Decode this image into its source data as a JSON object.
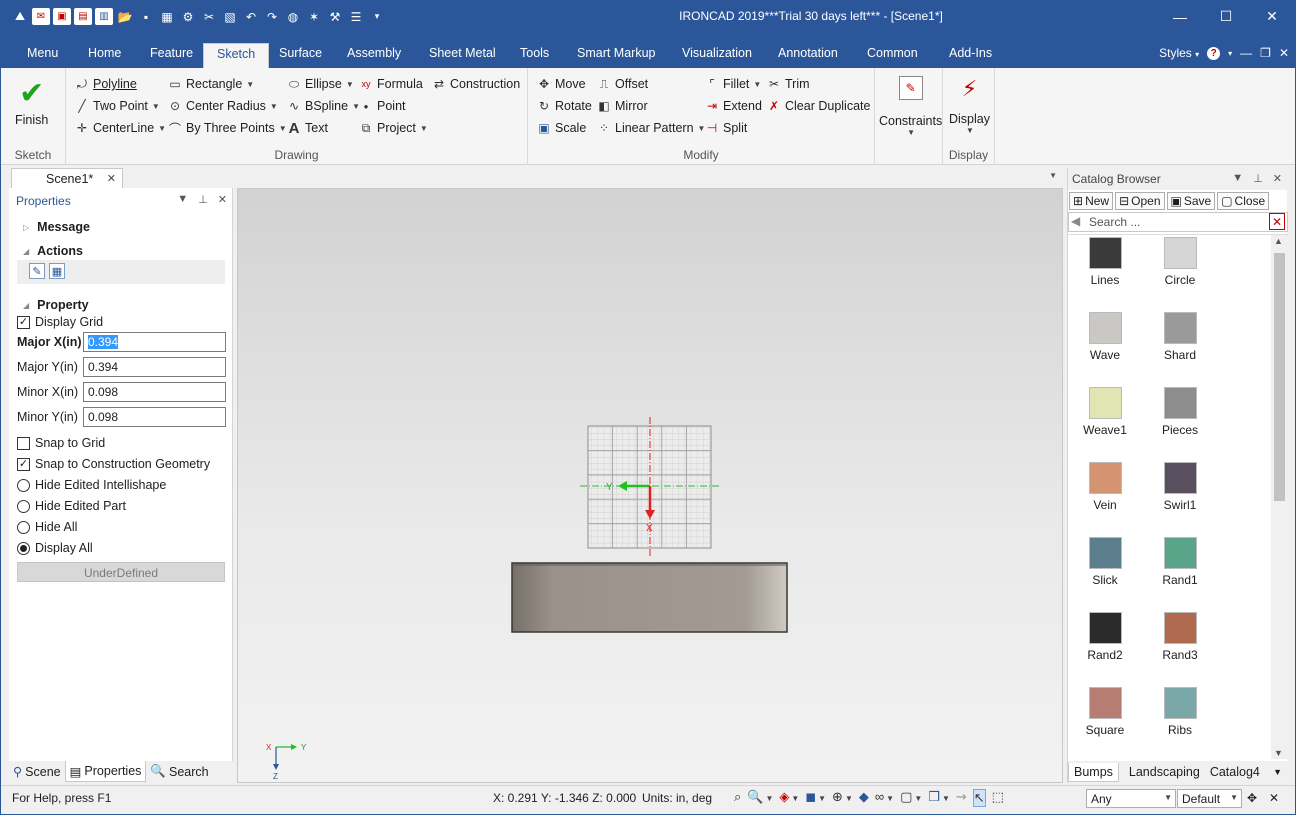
{
  "window": {
    "title": "IRONCAD 2019***Trial 30 days left*** - [Scene1*]"
  },
  "colors": {
    "titlebar": "#2b579a",
    "accent": "#2b579a",
    "selection": "#3399ff",
    "warning": "#c00000"
  },
  "menu_tabs": [
    {
      "label": "Menu"
    },
    {
      "label": "Home"
    },
    {
      "label": "Feature"
    },
    {
      "label": "Sketch"
    },
    {
      "label": "Surface"
    },
    {
      "label": "Assembly"
    },
    {
      "label": "Sheet Metal"
    },
    {
      "label": "Tools"
    },
    {
      "label": "Smart Markup"
    },
    {
      "label": "Visualization"
    },
    {
      "label": "Annotation"
    },
    {
      "label": "Common"
    },
    {
      "label": "Add-Ins"
    }
  ],
  "menu_right": {
    "styles_label": "Styles"
  },
  "ribbon": {
    "sketch": {
      "finish": "Finish",
      "group": "Sketch"
    },
    "drawing": {
      "group": "Drawing",
      "polyline": "Polyline",
      "two_point": "Two Point",
      "centerline": "CenterLine",
      "rectangle": "Rectangle",
      "center_radius": "Center Radius",
      "three_points": "By Three Points",
      "ellipse": "Ellipse",
      "bspline": "BSpline",
      "text": "Text",
      "formula": "Formula",
      "point": "Point",
      "project": "Project",
      "construction": "Construction"
    },
    "modify": {
      "group": "Modify",
      "move": "Move",
      "rotate": "Rotate",
      "scale": "Scale",
      "offset": "Offset",
      "mirror": "Mirror",
      "linear_pattern": "Linear Pattern",
      "fillet": "Fillet",
      "extend": "Extend",
      "split": "Split",
      "trim": "Trim",
      "clear_duplicate": "Clear Duplicate"
    },
    "constraints": {
      "label": "Constraints"
    },
    "display": {
      "label": "Display",
      "group": "Display"
    }
  },
  "document_tab": {
    "label": "Scene1*"
  },
  "properties": {
    "title": "Properties",
    "message": "Message",
    "actions": "Actions",
    "property": "Property",
    "display_grid": "Display Grid",
    "major_x_label": "Major X(in)",
    "major_x_value": "0.394",
    "major_y_label": "Major Y(in)",
    "major_y_value": "0.394",
    "minor_x_label": "Minor X(in)",
    "minor_x_value": "0.098",
    "minor_y_label": "Minor Y(in)",
    "minor_y_value": "0.098",
    "snap_grid": "Snap to Grid",
    "snap_construction": "Snap to Construction Geometry",
    "hide_intellishape": "Hide Edited Intellishape",
    "hide_part": "Hide Edited Part",
    "hide_all": "Hide All",
    "display_all": "Display All",
    "underdefined": "UnderDefined"
  },
  "left_tabs": {
    "scene": "Scene",
    "properties": "Properties",
    "search": "Search"
  },
  "viewport": {
    "axis_x": "X",
    "axis_y": "Y",
    "axis_z": "Z",
    "sketch_x": "X",
    "sketch_y": "Y"
  },
  "catalog": {
    "title": "Catalog Browser",
    "new": "New",
    "open": "Open",
    "save": "Save",
    "close": "Close",
    "search_placeholder": "Search ...",
    "items": [
      {
        "label": "Lines",
        "color": "#3a3a3a"
      },
      {
        "label": "Circle",
        "color": "#d6d6d6"
      },
      {
        "label": "Wave",
        "color": "#c9c8c4"
      },
      {
        "label": "Shard",
        "color": "#9a9a9a"
      },
      {
        "label": "Weave1",
        "color": "#e1e5b3"
      },
      {
        "label": "Pieces",
        "color": "#8d8d8d"
      },
      {
        "label": "Vein",
        "color": "#d49474"
      },
      {
        "label": "Swirl1",
        "color": "#5a4f5f"
      },
      {
        "label": "Slick",
        "color": "#5d7e8c"
      },
      {
        "label": "Rand1",
        "color": "#5aa58a"
      },
      {
        "label": "Rand2",
        "color": "#2a2a2a"
      },
      {
        "label": "Rand3",
        "color": "#b06a50"
      },
      {
        "label": "Square",
        "color": "#b67d73"
      },
      {
        "label": "Ribs",
        "color": "#7aa7a8"
      }
    ],
    "tabs": [
      "Bumps",
      "Landscaping",
      "Catalog4"
    ]
  },
  "status": {
    "help": "For Help, press F1",
    "coords": "X: 0.291 Y: -1.346 Z: 0.000",
    "units": "Units: in, deg",
    "filter": "Any",
    "mode": "Default"
  }
}
